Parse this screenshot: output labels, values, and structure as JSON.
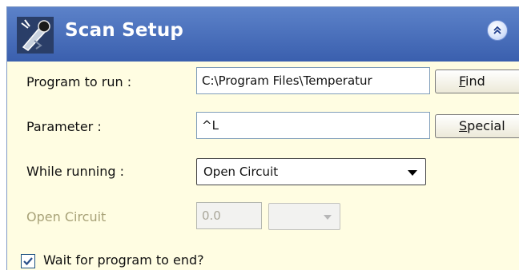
{
  "panel": {
    "title": "Scan Setup",
    "icon": "scan-tool-icon",
    "collapse_icon": "double-chevron-up-icon"
  },
  "fields": {
    "program": {
      "label": "Program to run :",
      "value": "C:\\Program Files\\Temperatur",
      "button_prefix": "",
      "button_underline": "F",
      "button_rest": "ind"
    },
    "parameter": {
      "label": "Parameter :",
      "value": "^L",
      "button_prefix": "",
      "button_underline": "S",
      "button_rest": "pecial"
    },
    "while_running": {
      "label": "While running :",
      "selected": "Open Circuit"
    },
    "open_circuit": {
      "label": "Open Circuit",
      "value": "0.0",
      "selected": ""
    },
    "wait": {
      "label": "Wait for program to end?",
      "checked": true
    }
  },
  "colors": {
    "header": "#4a70bd",
    "panel_bg": "#fffde2",
    "disabled_text": "#a8a278"
  }
}
